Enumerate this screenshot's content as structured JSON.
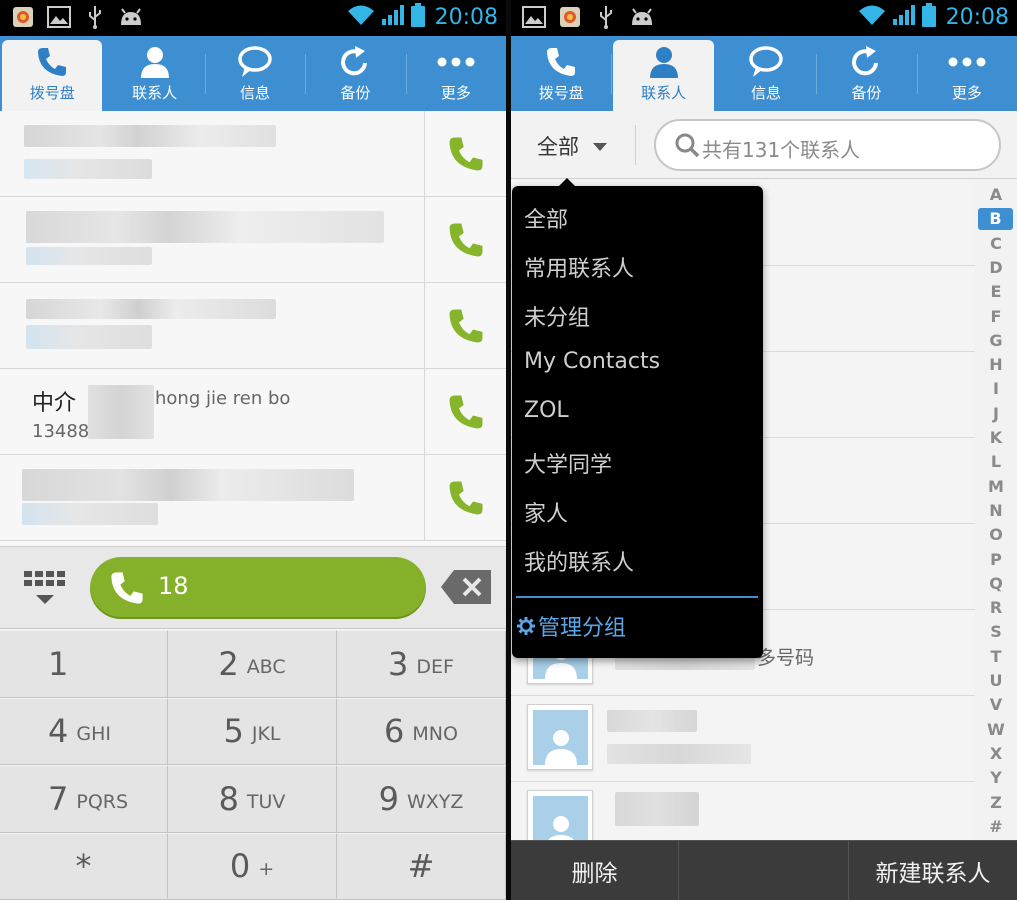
{
  "status_bar": {
    "time": "20:08"
  },
  "tabs": [
    {
      "label": "拨号盘",
      "icon": "phone-icon"
    },
    {
      "label": "联系人",
      "icon": "person-icon"
    },
    {
      "label": "信息",
      "icon": "message-icon"
    },
    {
      "label": "备份",
      "icon": "refresh-icon"
    },
    {
      "label": "更多",
      "icon": "more-icon"
    }
  ],
  "left": {
    "active_tab": "拨号盘",
    "call_log": [
      {
        "name": "",
        "pinyin": "",
        "number": ""
      },
      {
        "name": "",
        "pinyin": "",
        "number": ""
      },
      {
        "name": "",
        "pinyin": "",
        "number": ""
      },
      {
        "name": "中介",
        "pinyin": "hong jie ren bo",
        "number": "13488"
      },
      {
        "name": "",
        "pinyin": "",
        "number": ""
      }
    ],
    "dial_input": "18",
    "keypad": [
      {
        "digit": "1",
        "letters": ""
      },
      {
        "digit": "2",
        "letters": "ABC"
      },
      {
        "digit": "3",
        "letters": "DEF"
      },
      {
        "digit": "4",
        "letters": "GHI"
      },
      {
        "digit": "5",
        "letters": "JKL"
      },
      {
        "digit": "6",
        "letters": "MNO"
      },
      {
        "digit": "7",
        "letters": "PQRS"
      },
      {
        "digit": "8",
        "letters": "TUV"
      },
      {
        "digit": "9",
        "letters": "WXYZ"
      },
      {
        "digit": "*",
        "letters": ""
      },
      {
        "digit": "0",
        "letters": "+"
      },
      {
        "digit": "#",
        "letters": ""
      }
    ]
  },
  "right": {
    "active_tab": "联系人",
    "group_selector": "全部",
    "search_placeholder": "共有131个联系人",
    "dropdown": {
      "items": [
        "全部",
        "常用联系人",
        "未分组",
        "My Contacts",
        "ZOL",
        "大学同学",
        "家人",
        "我的联系人"
      ],
      "manage": "管理分组"
    },
    "multi_number_label": "多号码",
    "alphabet": [
      "A",
      "B",
      "C",
      "D",
      "E",
      "F",
      "G",
      "H",
      "I",
      "J",
      "K",
      "L",
      "M",
      "N",
      "O",
      "P",
      "Q",
      "R",
      "S",
      "T",
      "U",
      "V",
      "W",
      "X",
      "Y",
      "Z",
      "#"
    ],
    "alphabet_selected": "B",
    "bottom": {
      "delete": "删除",
      "new_contact": "新建联系人"
    }
  },
  "colors": {
    "tab_blue": "#3d8fd2",
    "call_green": "#85b02a",
    "phone_icon_green": "#86b52c",
    "link_blue": "#5aa8ea",
    "clock_blue": "#33b5e5"
  }
}
